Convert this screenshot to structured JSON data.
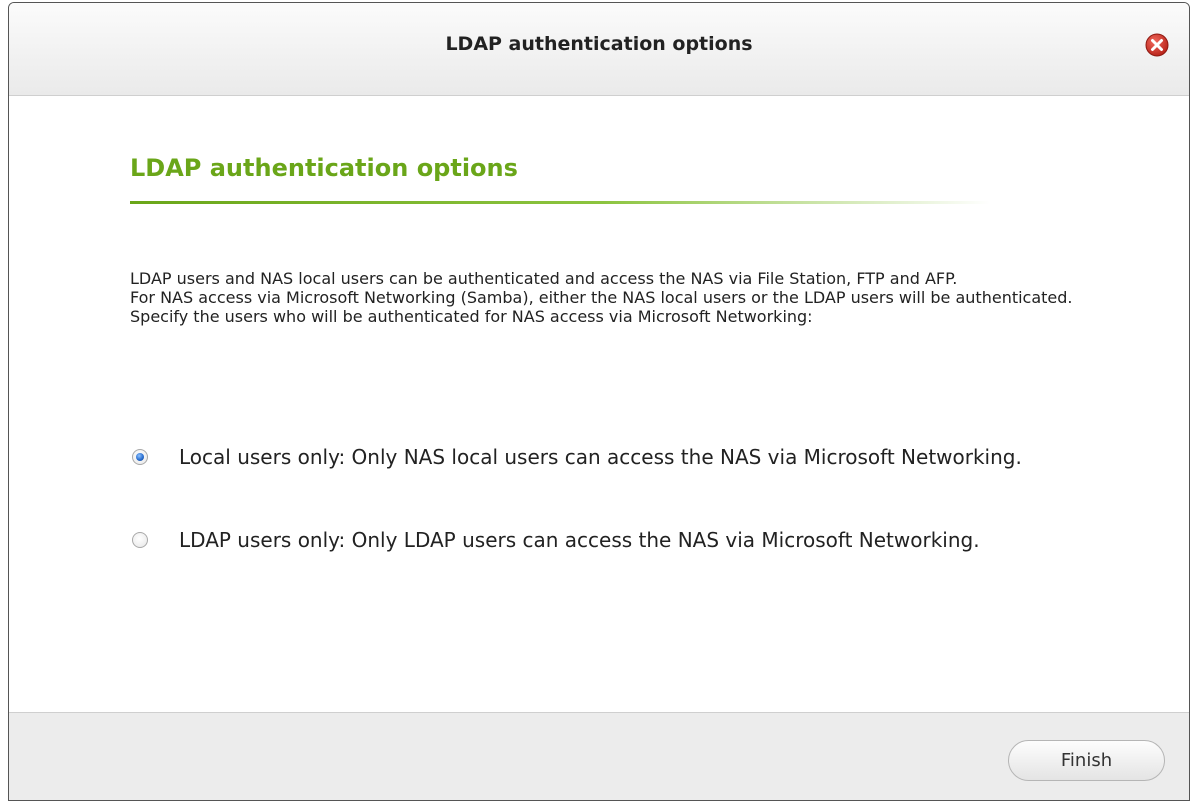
{
  "dialog": {
    "title": "LDAP authentication options",
    "close_icon": "close-icon"
  },
  "main": {
    "heading": "LDAP authentication options",
    "description": [
      "LDAP users and NAS local users can be authenticated and access the NAS via File Station, FTP and AFP.",
      "For NAS access via Microsoft Networking (Samba), either the NAS local users or the LDAP users will be authenticated.",
      "Specify the users who will be authenticated for NAS access via Microsoft Networking:"
    ],
    "options": [
      {
        "label": "Local users only: Only NAS local users can access the NAS via Microsoft Networking.",
        "selected": true
      },
      {
        "label": "LDAP users only: Only LDAP users can access the NAS via Microsoft Networking.",
        "selected": false
      }
    ]
  },
  "footer": {
    "finish_label": "Finish"
  },
  "colors": {
    "heading_green": "#6aa619",
    "close_red": "#d9342b",
    "radio_selected_blue": "#2a6fd0"
  }
}
